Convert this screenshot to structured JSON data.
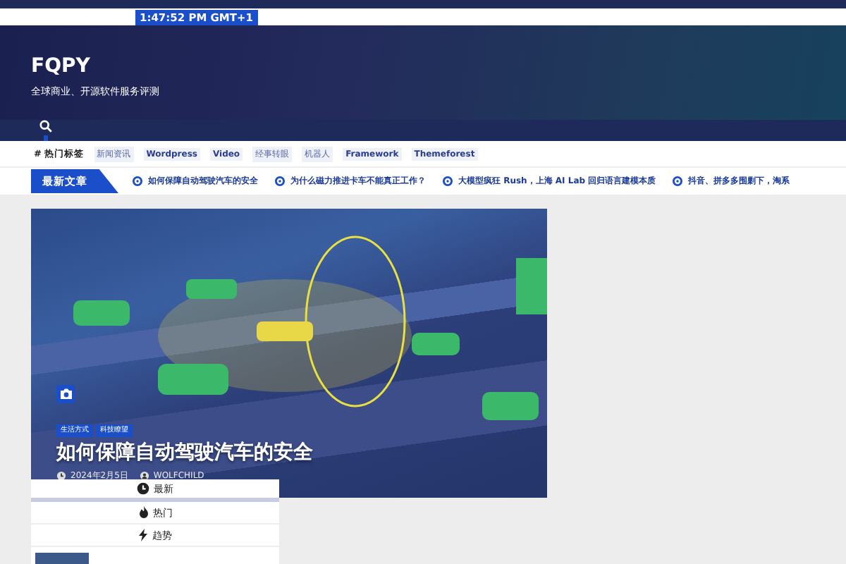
{
  "top_bar": {
    "time": "1:47:52 PM GMT+1"
  },
  "header": {
    "logo": "FQPY",
    "tagline": "全球商业、开源软件服务评测"
  },
  "hot_tags": {
    "label": "# 热门标签",
    "tags": [
      {
        "label": "新闻资讯",
        "kind": "cjk"
      },
      {
        "label": "Wordpress",
        "kind": "latin"
      },
      {
        "label": "Video",
        "kind": "latin"
      },
      {
        "label": "经事转眼",
        "kind": "cjk"
      },
      {
        "label": "机器人",
        "kind": "cjk"
      },
      {
        "label": "Framework",
        "kind": "latin"
      },
      {
        "label": "Themeforest",
        "kind": "latin"
      }
    ]
  },
  "ticker": {
    "label": "最新文章",
    "items": [
      "如何保障自动驾驶汽车的安全",
      "为什么磁力推进卡车不能真正工作？",
      "大模型疯狂 Rush，上海 AI Lab 回归语言建模本质",
      "抖音、拼多多围剿下，淘系"
    ]
  },
  "featured": {
    "categories": [
      "生活方式",
      "科技瞭望"
    ],
    "title": "如何保障自动驾驶汽车的安全",
    "date": "2024年2月5日",
    "author": "WOLFCHILD"
  },
  "tabs": [
    {
      "label": "最新",
      "selected": true
    },
    {
      "label": "热门",
      "selected": false
    },
    {
      "label": "趋势",
      "selected": false
    }
  ]
}
